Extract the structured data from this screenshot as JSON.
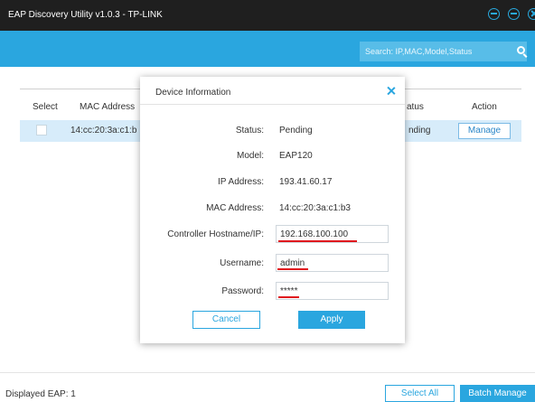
{
  "app": {
    "title": "EAP Discovery Utility v1.0.3 - TP-LINK"
  },
  "window_controls": [
    "minimize-icon",
    "settings-icon",
    "close-icon"
  ],
  "search": {
    "placeholder": "Search: IP,MAC,Model,Status"
  },
  "table": {
    "columns": {
      "select": "Select",
      "mac": "MAC Address",
      "status": "atus",
      "action": "Action"
    },
    "rows": [
      {
        "mac": "14:cc:20:3a:c1:b",
        "status": "nding",
        "action": "Manage"
      }
    ]
  },
  "dialog": {
    "title": "Device Information",
    "status_label": "Status:",
    "status_value": "Pending",
    "model_label": "Model:",
    "model_value": "EAP120",
    "ip_label": "IP Address:",
    "ip_value": "193.41.60.17",
    "mac_label": "MAC Address:",
    "mac_value": "14:cc:20:3a:c1:b3",
    "controller_label": "Controller Hostname/IP:",
    "controller_value": "192.168.100.100",
    "username_label": "Username:",
    "username_value": "admin",
    "password_label": "Password:",
    "password_value": "*****",
    "cancel_label": "Cancel",
    "apply_label": "Apply"
  },
  "footer": {
    "displayed_eap": "Displayed EAP: 1",
    "select_all_label": "Select All",
    "batch_manage_label": "Batch Manage"
  },
  "colors": {
    "accent": "#2aa6df",
    "titlebar": "#1f1f1f",
    "row_highlight": "#d7ecfa",
    "underline": "#e0191e"
  }
}
